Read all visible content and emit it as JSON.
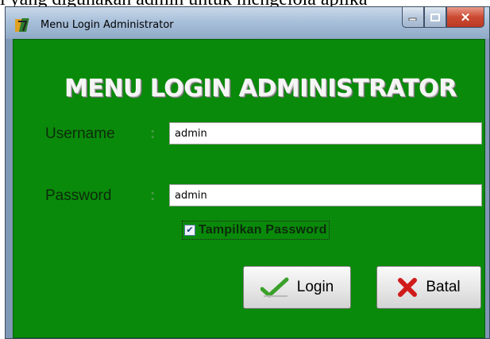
{
  "background": {
    "text": "i yang digunakan admin untuk mengelola aplika"
  },
  "window": {
    "title": "Menu Login Administrator",
    "icon": "app-icon",
    "controls": [
      "minimize-icon",
      "maximize-icon",
      "close-icon"
    ]
  },
  "form": {
    "heading": "MENU LOGIN ADMINISTRATOR",
    "username_label": "Username",
    "username_value": "admin",
    "password_label": "Password",
    "password_value": "admin",
    "colon": ":",
    "show_password_label": "Tampilkan Password",
    "show_password_checked": true,
    "login_label": "Login",
    "cancel_label": "Batal"
  },
  "colors": {
    "form_background": "#0a8a0a",
    "heading": "#f5f5f5",
    "close_button": "#cc4a32"
  }
}
